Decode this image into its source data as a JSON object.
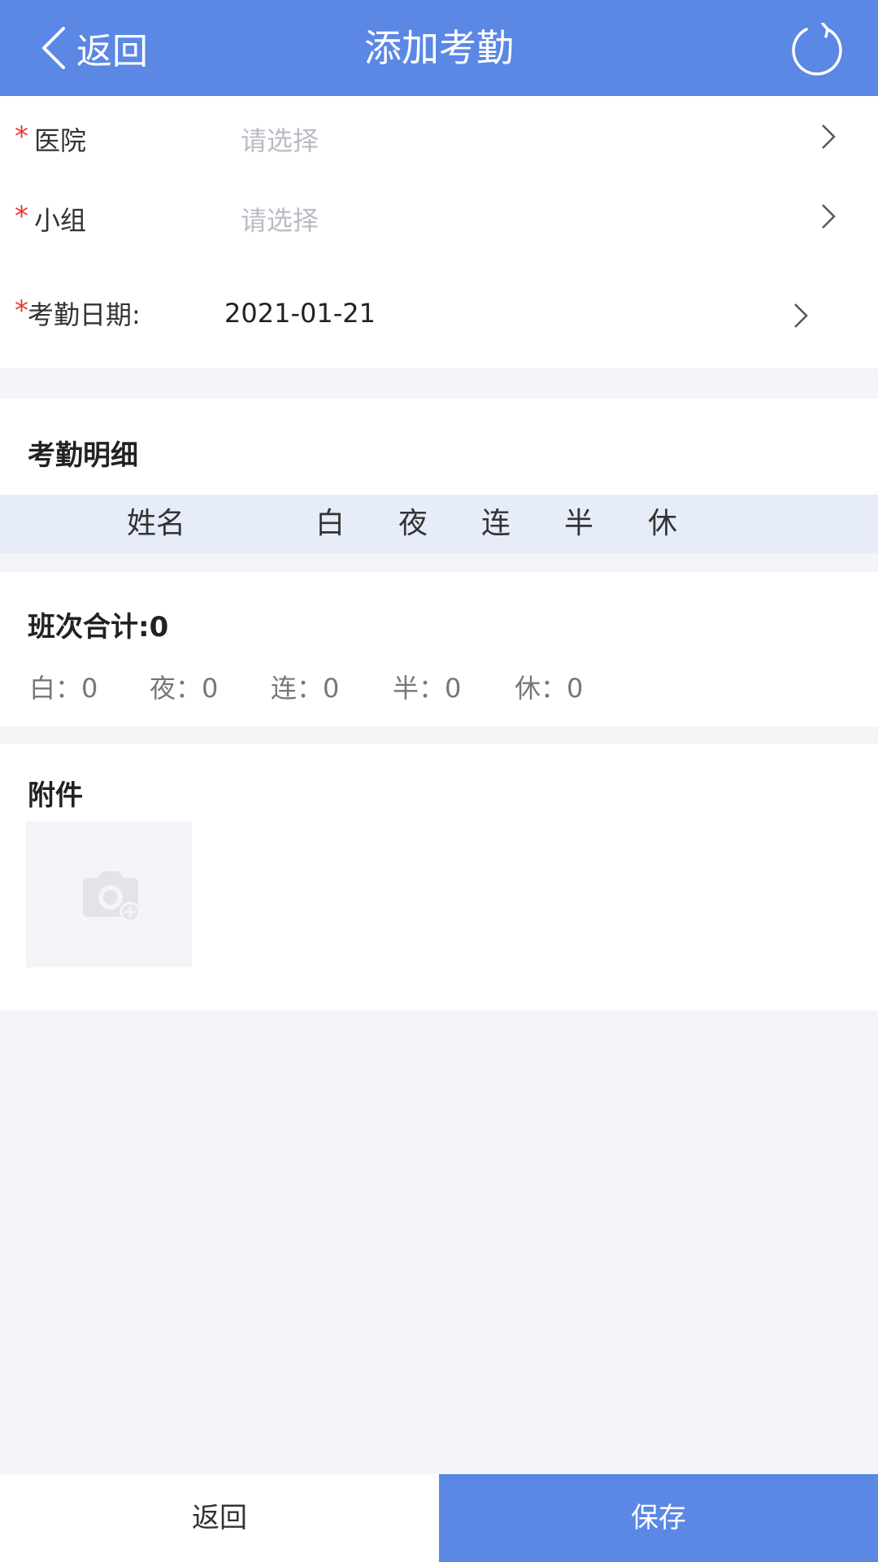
{
  "header": {
    "back_label": "返回",
    "title": "添加考勤",
    "color": "#5b87e5"
  },
  "form": {
    "required_mark": "*",
    "hospital": {
      "label": "医院",
      "placeholder": "请选择"
    },
    "group": {
      "label": "小组",
      "placeholder": "请选择"
    },
    "date": {
      "label": "考勤日期:",
      "value": "2021-01-21"
    }
  },
  "detail": {
    "title": "考勤明细",
    "columns": [
      "姓名",
      "白",
      "夜",
      "连",
      "半",
      "休"
    ]
  },
  "summary": {
    "total": "班次合计:0",
    "stats": [
      {
        "label": "白",
        "value": "0"
      },
      {
        "label": "夜",
        "value": "0"
      },
      {
        "label": "连",
        "value": "0"
      },
      {
        "label": "半",
        "value": "0"
      },
      {
        "label": "休",
        "value": "0"
      }
    ]
  },
  "attachment": {
    "title": "附件",
    "upload_icon": "camera-add-icon"
  },
  "footer": {
    "back_label": "返回",
    "save_label": "保存"
  }
}
